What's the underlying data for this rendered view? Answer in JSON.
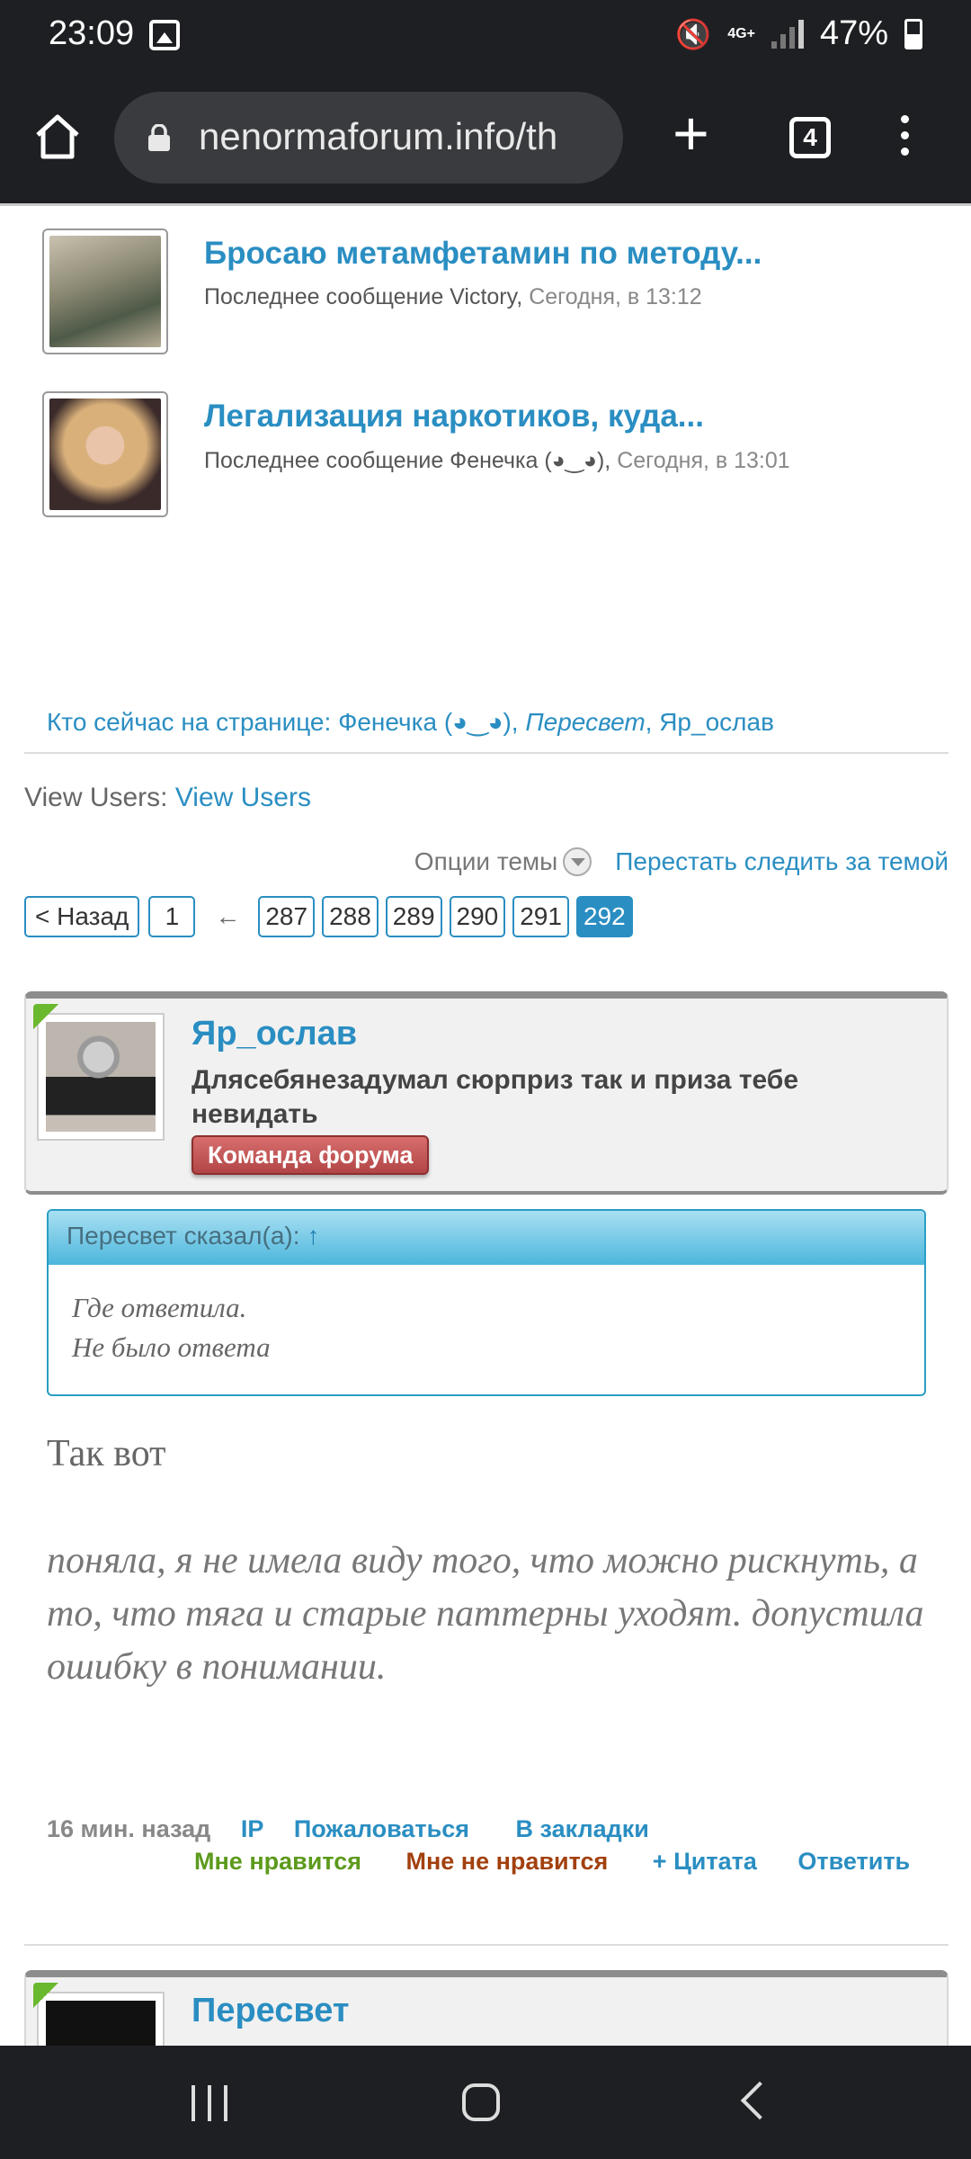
{
  "status_bar": {
    "time": "23:09",
    "network": "4G+",
    "battery": "47%",
    "icons": [
      "image-icon",
      "mute-icon",
      "network-icon",
      "signal-icon",
      "battery-icon"
    ]
  },
  "browser": {
    "url": "nenormaforum.info/th",
    "tab_count": "4",
    "icons": [
      "home-icon",
      "lock-icon",
      "plus-icon",
      "tabs-icon",
      "menu-icon"
    ]
  },
  "threads": [
    {
      "title": "Бросаю метамфетамин по методу...",
      "meta_prefix": "Последнее сообщение Victory,",
      "when": "Сегодня, в 13:12"
    },
    {
      "title": "Легализация наркотиков, куда...",
      "meta_prefix": "Последнее сообщение Фенечка (◕‿◕),",
      "when": "Сегодня, в 13:01"
    }
  ],
  "who_is_here": {
    "label": "Кто сейчас на странице: Фенечка (◕‿◕), ",
    "italic_user": "Пересвет",
    "rest": ", Яр_ослав"
  },
  "view_users": {
    "label": "View Users: ",
    "link": "View Users"
  },
  "thread_options": {
    "options_label": "Опции темы",
    "unfollow_label": "Перестать следить за темой"
  },
  "pagination": {
    "back": "< Назад",
    "first": "1",
    "ellipsis": "←",
    "pages": [
      "287",
      "288",
      "289",
      "290",
      "291"
    ],
    "current": "292"
  },
  "post": {
    "author": "Яр_ослав",
    "status": "Длясебянезадумал сюрприз так и приза тебе невидать",
    "badge": "Команда форума",
    "quote_header": "Пересвет сказал(а): ",
    "quote_arrow": "↑",
    "quote_line1": "Где ответила.",
    "quote_line2": "Не было ответа",
    "text1": "Так вот",
    "text2": "поняла, я не имела виду того, что можно рискнуть, а то, что тяга и старые паттерны уходят. допустила ошибку в понимании.",
    "time": "16 мин. назад",
    "ip": "IP",
    "report": "Пожаловаться",
    "bookmark": "В закладки",
    "like": "Мне нравится",
    "dislike": "Мне не нравится",
    "quote": "+ Цитата",
    "reply": "Ответить"
  },
  "next_post": {
    "author": "Пересвет"
  },
  "colors": {
    "link": "#2a8ec2",
    "like": "#5d9a1c",
    "dislike": "#a2400e",
    "badge": "#b24545",
    "bars": "#1e1f22"
  }
}
